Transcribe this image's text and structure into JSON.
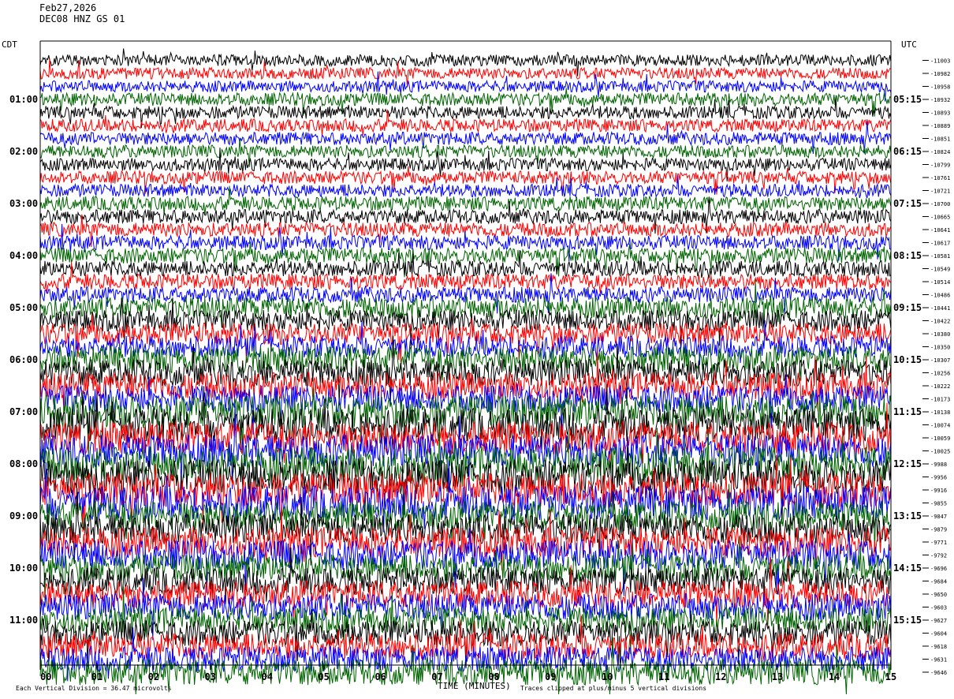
{
  "header": {
    "date": "Feb27,2026",
    "station": "DEC08 HNZ GS 01"
  },
  "left_axis_title": "CDT",
  "right_axis_title": "UTC",
  "footer": {
    "left_note": "Each Vertical Division = 36.47 microvolts",
    "x_axis_label": "TIME (MINUTES)",
    "right_note": "Traces clipped at plus/minus 5 vertical divisions"
  },
  "colors": {
    "trace_cycle": [
      "#000000",
      "#ff0000",
      "#0000ff",
      "#006400"
    ],
    "background": "#ffffff",
    "grid": "#000000"
  },
  "chart_data": {
    "type": "line",
    "title": "",
    "xlabel": "TIME (MINUTES)",
    "ylabel": "",
    "xlim": [
      0,
      15
    ],
    "x_ticks": [
      "00",
      "01",
      "02",
      "03",
      "04",
      "05",
      "06",
      "07",
      "08",
      "09",
      "10",
      "11",
      "12",
      "13",
      "14",
      "15"
    ],
    "left_time_labels": [
      "01:00",
      "02:00",
      "03:00",
      "04:00",
      "05:00",
      "06:00",
      "07:00",
      "08:00",
      "09:00",
      "10:00",
      "11:00"
    ],
    "right_time_labels": [
      "05:15",
      "06:15",
      "07:15",
      "08:15",
      "09:15",
      "10:15",
      "11:15",
      "12:15",
      "13:15",
      "14:15",
      "15:15"
    ],
    "traces_per_hour": 4,
    "first_trace_offset_hours": -0.75,
    "trace_count": 48,
    "right_values": [
      "-11003",
      "-10982",
      "-10958",
      "-10932",
      "-10893",
      "-10889",
      "-10851",
      "-10824",
      "-10799",
      "-10761",
      "-10721",
      "-10700",
      "-10665",
      "-10641",
      "-10617",
      "-10581",
      "-10549",
      "-10514",
      "-10486",
      "-10441",
      "-10422",
      "-10380",
      "-10350",
      "-10307",
      "-10256",
      "-10222",
      "-10173",
      "-10138",
      "-10074",
      "-10059",
      "-10025",
      "-9988",
      "-9956",
      "-9916",
      "-9855",
      "-9847",
      "-9879",
      "-9771",
      "-9792",
      "-9696",
      "-9684",
      "-9650",
      "-9603",
      "-9627",
      "-9604",
      "-9618",
      "-9631",
      "-9646"
    ],
    "amplitude_profile_by_hour": [
      0.8,
      0.9,
      0.9,
      1.0,
      1.1,
      1.5,
      1.9,
      2.3,
      2.4,
      2.1,
      1.9,
      1.8
    ]
  }
}
